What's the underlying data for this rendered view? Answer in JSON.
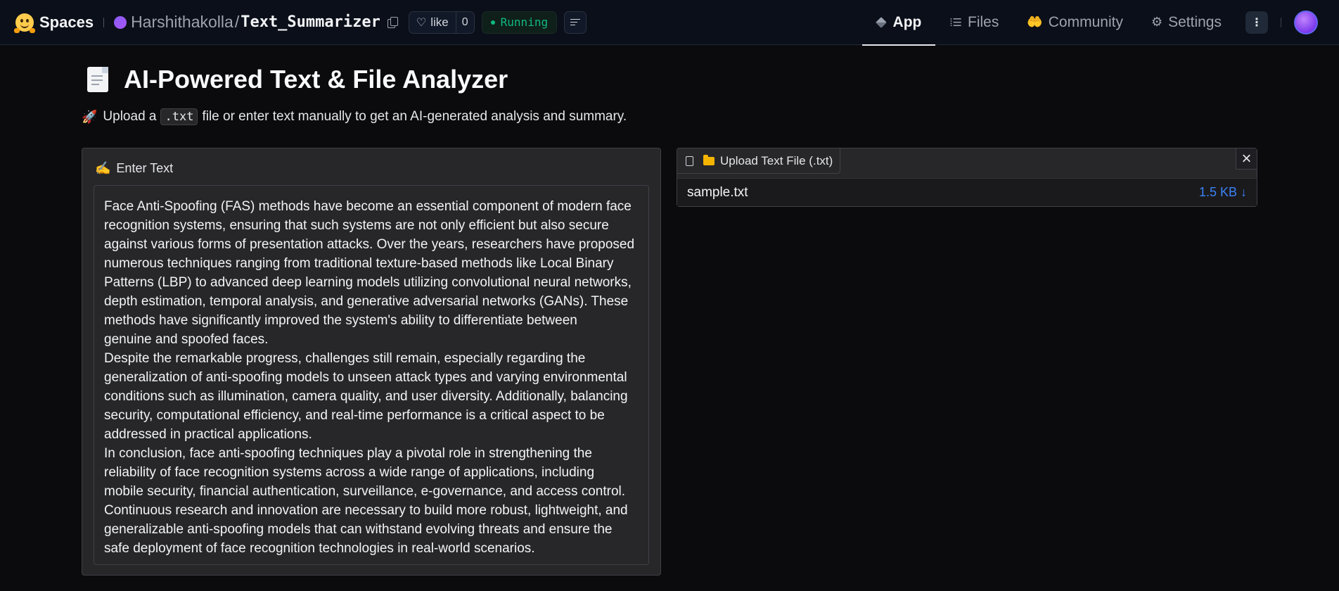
{
  "nav": {
    "brand": "Spaces",
    "owner": "Harshithakolla",
    "separator": "/",
    "repo": "Text_Summarizer",
    "like_label": "like",
    "like_count": "0",
    "status": "Running",
    "tabs": [
      {
        "label": "App",
        "icon": "cube-icon",
        "active": true
      },
      {
        "label": "Files",
        "icon": "files-icon",
        "active": false
      },
      {
        "label": "Community",
        "icon": "community-icon",
        "active": false
      },
      {
        "label": "Settings",
        "icon": "gear-icon",
        "active": false
      }
    ]
  },
  "main": {
    "title": "AI-Powered Text & File Analyzer",
    "subtitle_prefix": "Upload a",
    "subtitle_code": ".txt",
    "subtitle_suffix": "file or enter text manually to get an AI-generated analysis and summary.",
    "text_panel": {
      "label": "Enter Text",
      "value": "Face Anti-Spoofing (FAS) methods have become an essential component of modern face\nrecognition systems, ensuring that such systems are not only efficient but also secure\nagainst various forms of presentation attacks. Over the years, researchers have proposed\nnumerous techniques ranging from traditional texture-based methods like Local Binary\nPatterns (LBP) to advanced deep learning models utilizing convolutional neural networks,\ndepth estimation, temporal analysis, and generative adversarial networks (GANs). These\nmethods have significantly improved the system's ability to differentiate between\ngenuine and spoofed faces.\nDespite the remarkable progress, challenges still remain, especially regarding the\ngeneralization of anti-spoofing models to unseen attack types and varying environmental\nconditions such as illumination, camera quality, and user diversity. Additionally, balancing\nsecurity, computational efficiency, and real-time performance is a critical aspect to be\naddressed in practical applications.\nIn conclusion, face anti-spoofing techniques play a pivotal role in strengthening the\nreliability of face recognition systems across a wide range of applications, including\nmobile security, financial authentication, surveillance, e-governance, and access control.\nContinuous research and innovation are necessary to build more robust, lightweight, and\ngeneralizable anti-spoofing models that can withstand evolving threats and ensure the\nsafe deployment of face recognition technologies in real-world scenarios."
    },
    "file_panel": {
      "label": "Upload Text File (.txt)",
      "close": "×",
      "file_name": "sample.txt",
      "file_size": "1.5 KB ↓"
    }
  },
  "colors": {
    "status": "#10b981",
    "link": "#3b82f6",
    "nav_bg": "#0b0f19",
    "page_bg": "#0b0b0d"
  }
}
